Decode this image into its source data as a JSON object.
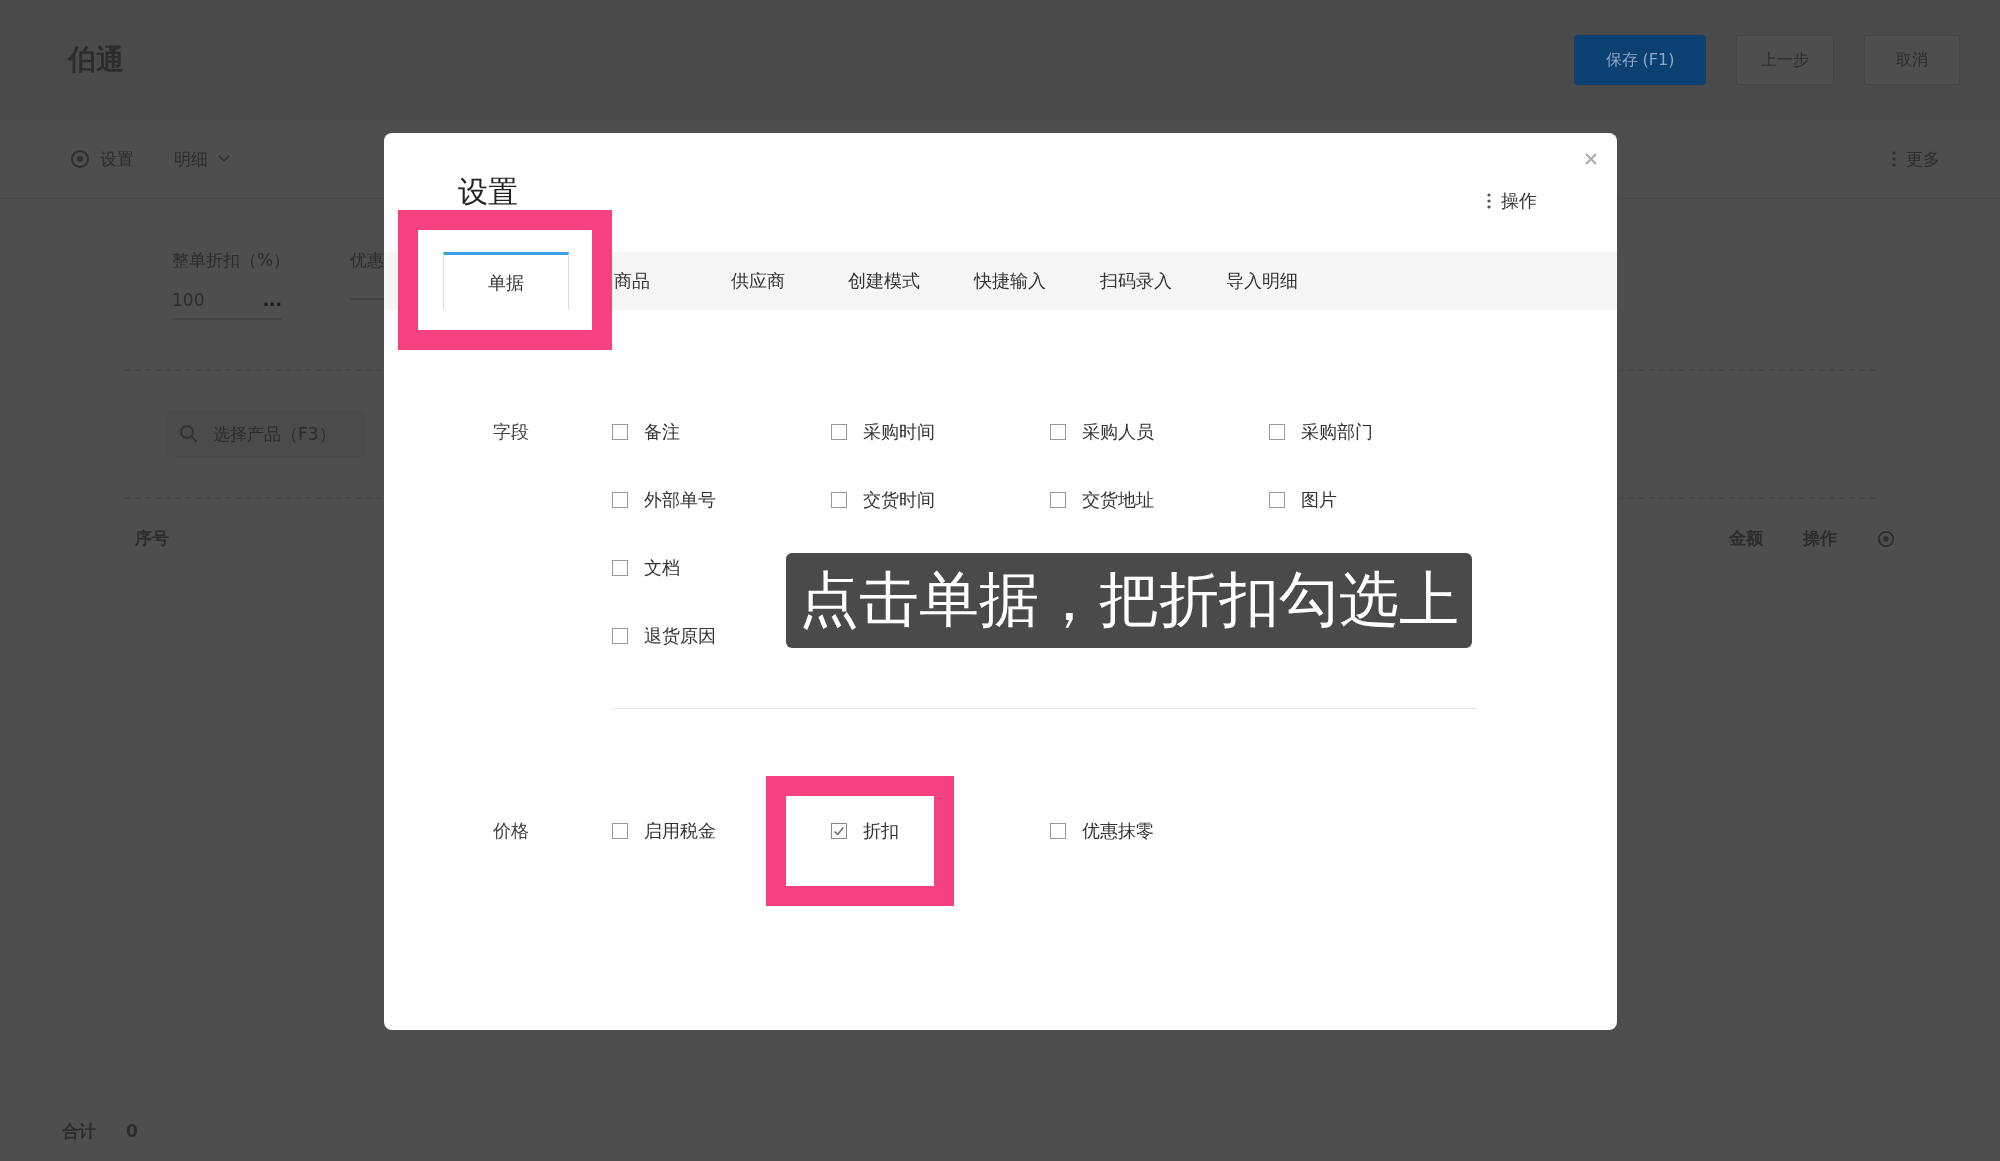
{
  "app": {
    "title": "伯通",
    "buttons": [
      {
        "label": "保存 (F1)",
        "kind": "primary"
      },
      {
        "label": "上一步",
        "kind": "default"
      },
      {
        "label": "取消",
        "kind": "default"
      }
    ]
  },
  "toolbar": {
    "settings": "设置",
    "view": "明细",
    "more": "更多"
  },
  "form": [
    {
      "label": "整单折扣（%）",
      "value": "100",
      "suffix": "..."
    },
    {
      "label": "优惠"
    }
  ],
  "product_search": {
    "placeholder": "选择产品（F3）"
  },
  "table": {
    "columns": [
      "序号",
      "金额",
      "操作"
    ]
  },
  "footer": {
    "label": "合计",
    "value": "0"
  },
  "dialog": {
    "title": "设置",
    "actions": "操作",
    "tabs": [
      {
        "label": "单据",
        "selected": true,
        "highlighted": true
      },
      {
        "label": "商品",
        "selected": false,
        "highlighted": false
      },
      {
        "label": "供应商",
        "selected": false,
        "highlighted": false
      },
      {
        "label": "创建模式",
        "selected": false,
        "highlighted": false
      },
      {
        "label": "快捷输入",
        "selected": false,
        "highlighted": false
      },
      {
        "label": "扫码录入",
        "selected": false,
        "highlighted": false
      },
      {
        "label": "导入明细",
        "selected": false,
        "highlighted": false
      }
    ],
    "sections": [
      {
        "label": "字段",
        "rows": [
          [
            {
              "label": "备注",
              "checked": false,
              "highlighted": false
            },
            {
              "label": "采购时间",
              "checked": false,
              "highlighted": false
            },
            {
              "label": "采购人员",
              "checked": false,
              "highlighted": false
            },
            {
              "label": "采购部门",
              "checked": false,
              "highlighted": false
            }
          ],
          [
            {
              "label": "外部单号",
              "checked": false,
              "highlighted": false
            },
            {
              "label": "交货时间",
              "checked": false,
              "highlighted": false
            },
            {
              "label": "交货地址",
              "checked": false,
              "highlighted": false
            },
            {
              "label": "图片",
              "checked": false,
              "highlighted": false
            }
          ],
          [
            {
              "label": "文档",
              "checked": false,
              "highlighted": false
            }
          ],
          [
            {
              "label": "退货原因",
              "checked": false,
              "highlighted": false
            }
          ]
        ]
      },
      {
        "label": "价格",
        "rows": [
          [
            {
              "label": "启用税金",
              "checked": false,
              "highlighted": false
            },
            {
              "label": "折扣",
              "checked": true,
              "highlighted": true
            },
            {
              "label": "优惠抹零",
              "checked": false,
              "highlighted": false
            }
          ]
        ]
      }
    ]
  },
  "caption": "点击单据，把折扣勾选上"
}
